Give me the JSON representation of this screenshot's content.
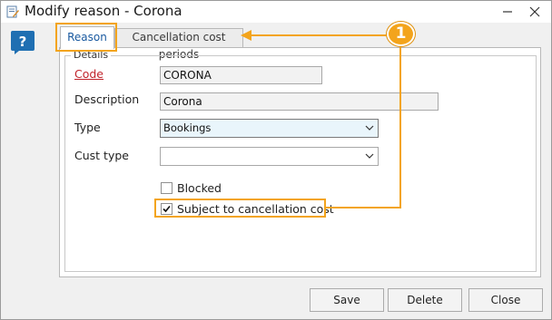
{
  "window": {
    "title": "Modify reason - Corona",
    "minimize_icon": "minimize-icon",
    "close_icon": "close-icon"
  },
  "help": {
    "icon": "help-question-icon",
    "color": "#1f6fb2"
  },
  "tabs": [
    {
      "label": "Reason",
      "active": true
    },
    {
      "label": "Cancellation cost periods",
      "active": false
    }
  ],
  "details": {
    "group_label": "Details",
    "code": {
      "label": "Code",
      "value": "CORONA"
    },
    "description": {
      "label": "Description",
      "value": "Corona"
    },
    "type": {
      "label": "Type",
      "value": "Bookings"
    },
    "cust_type": {
      "label": "Cust type",
      "value": ""
    },
    "blocked": {
      "label": "Blocked",
      "checked": false
    },
    "subject_to_cancellation_cost": {
      "label": "Subject to cancellation cost",
      "checked": true
    }
  },
  "buttons": {
    "save": "Save",
    "delete": "Delete",
    "close": "Close"
  },
  "annotation": {
    "badge": "1",
    "color": "#f3a41c"
  }
}
